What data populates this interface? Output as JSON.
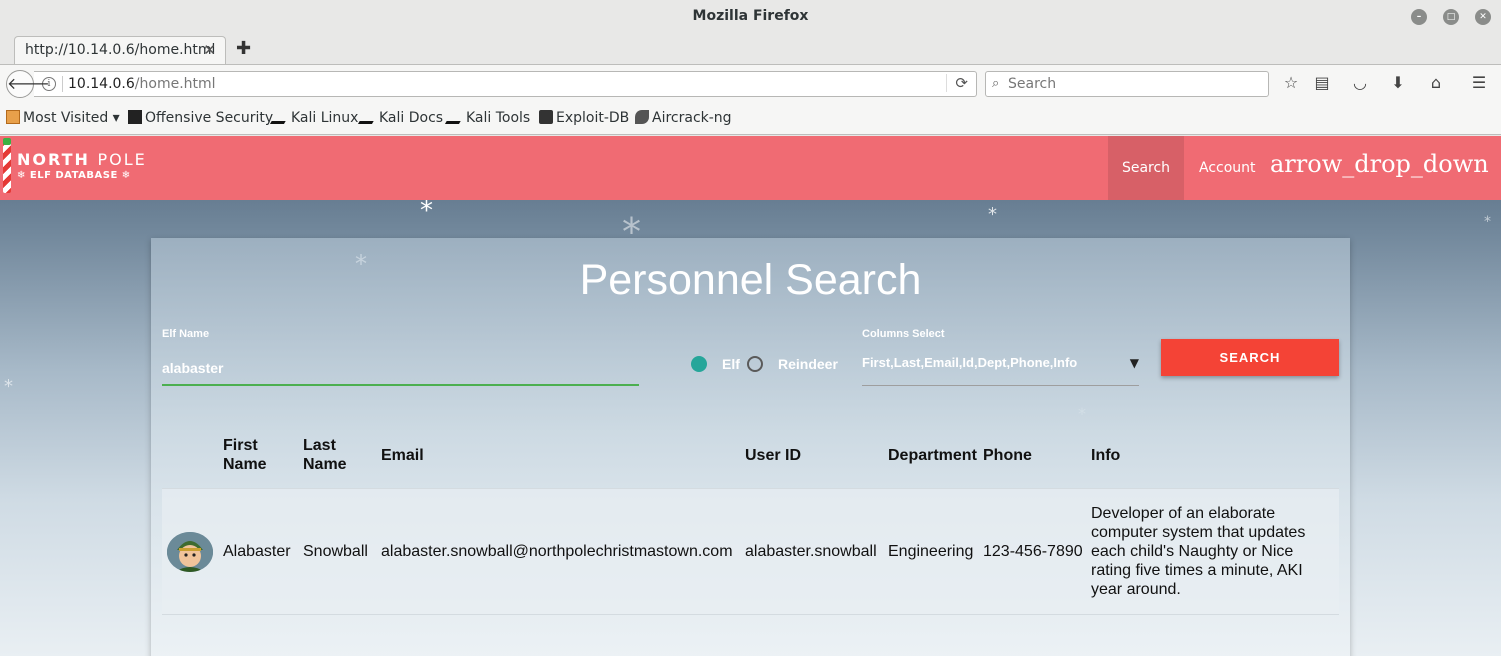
{
  "window": {
    "title": "Mozilla Firefox"
  },
  "tab": {
    "label": "http://10.14.0.6/home.html",
    "close": "✕",
    "new_tab": "✚"
  },
  "navbar": {
    "url_host": "10.14.0.6",
    "url_path": "/home.html",
    "search_placeholder": "Search"
  },
  "bookmarks": [
    {
      "label": "Most Visited ▾",
      "icon": "most-visited-icon"
    },
    {
      "label": "Offensive Security",
      "icon": "offsec-icon"
    },
    {
      "label": "Kali Linux",
      "icon": "kali-icon"
    },
    {
      "label": "Kali Docs",
      "icon": "kali-icon"
    },
    {
      "label": "Kali Tools",
      "icon": "kali-icon"
    },
    {
      "label": "Exploit-DB",
      "icon": "exploitdb-icon"
    },
    {
      "label": "Aircrack-ng",
      "icon": "aircrack-icon"
    }
  ],
  "app": {
    "logo_line1a": "NORTH",
    "logo_line1b": "POLE",
    "logo_line2": "❄ ELF DATABASE ❄",
    "nav_search": "Search",
    "nav_account": "Account",
    "nav_dropdown": "arrow_drop_down"
  },
  "form": {
    "title": "Personnel Search",
    "elf_name_label": "Elf Name",
    "elf_name_value": "alabaster",
    "radio_elf": "Elf",
    "radio_reindeer": "Reindeer",
    "columns_label": "Columns Select",
    "columns_value": "First,Last,Email,Id,Dept,Phone,Info",
    "search_button": "SEARCH"
  },
  "table": {
    "headers": {
      "first": [
        "First",
        "Name"
      ],
      "last": [
        "Last",
        "Name"
      ],
      "email": "Email",
      "userid": "User ID",
      "dept": "Department",
      "phone": "Phone",
      "info": "Info"
    },
    "row": {
      "first": "Alabaster",
      "last": "Snowball",
      "email": "alabaster.snowball@northpolechristmastown.com",
      "userid": "alabaster.snowball",
      "dept": "Engineering",
      "phone": "123-456-7890",
      "info": [
        "Developer of an elaborate",
        "computer system that updates",
        "each child's Naughty or Nice",
        "rating five times a minute, AKI",
        "year around."
      ]
    }
  },
  "colors": {
    "appbar": "#f06b73",
    "search_button": "#f44336",
    "radio_selected": "#26a69a",
    "input_underline": "#4caf50"
  }
}
